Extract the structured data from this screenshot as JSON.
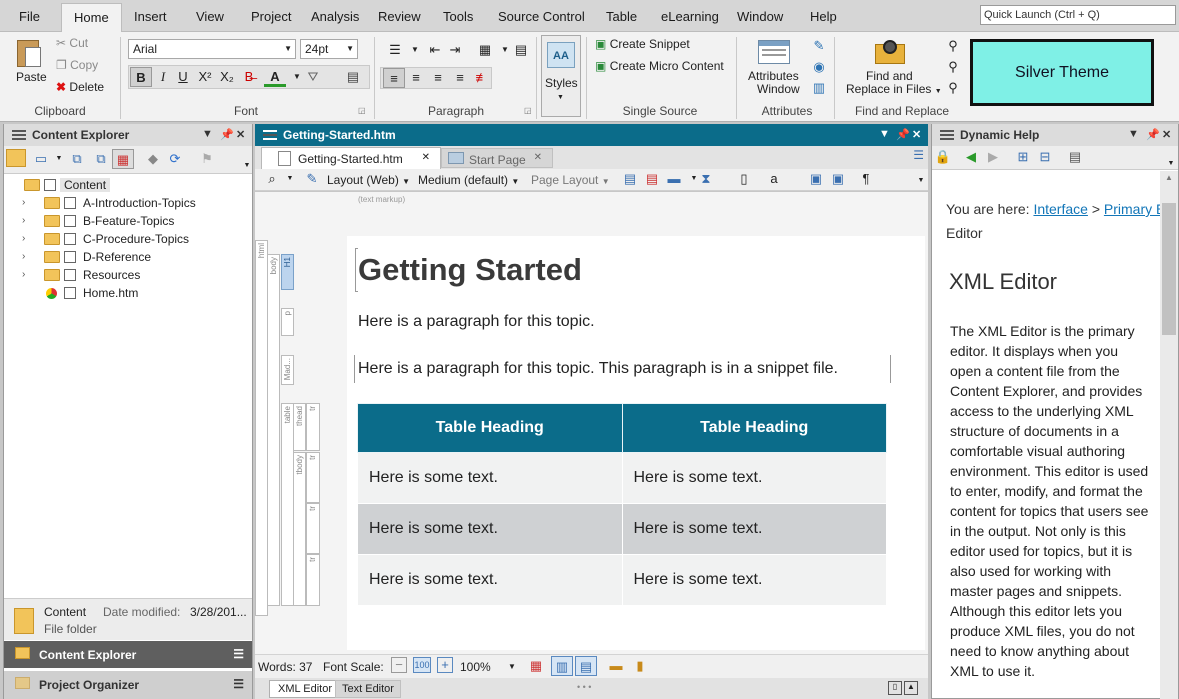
{
  "menu": {
    "items": [
      "File",
      "Home",
      "Insert",
      "View",
      "Project",
      "Analysis",
      "Review",
      "Tools",
      "Source Control",
      "Table",
      "eLearning",
      "Window",
      "Help"
    ],
    "active": "Home",
    "quick_launch": "Quick Launch (Ctrl + Q)"
  },
  "ribbon": {
    "clipboard": {
      "label": "Clipboard",
      "paste": "Paste",
      "cut": "Cut",
      "copy": "Copy",
      "delete": "Delete"
    },
    "font": {
      "label": "Font",
      "family": "Arial",
      "size": "24pt",
      "bold": "B",
      "italic": "I",
      "underline": "U",
      "superscript": "X²",
      "subscript": "X₂",
      "strike": "B̶",
      "font_color": "A"
    },
    "paragraph": {
      "label": "Paragraph"
    },
    "styles": {
      "label": "Styles"
    },
    "single_source": {
      "label": "Single Source",
      "create_snippet": "Create Snippet",
      "create_micro": "Create Micro Content"
    },
    "attributes": {
      "label": "Attributes",
      "window_line1": "Attributes",
      "window_line2": "Window"
    },
    "find": {
      "label": "Find and Replace",
      "btn_line1": "Find and",
      "btn_line2": "Replace in Files"
    },
    "theme": "Silver Theme"
  },
  "content_explorer": {
    "title": "Content Explorer",
    "root": "Content",
    "items": [
      "A-Introduction-Topics",
      "B-Feature-Topics",
      "C-Procedure-Topics",
      "D-Reference",
      "Resources",
      "Home.htm"
    ],
    "info": {
      "name": "Content",
      "modified_label": "Date modified:",
      "modified_value": "3/28/201...",
      "type": "File folder"
    },
    "bottom_tabs": [
      "Content Explorer",
      "Project Organizer"
    ]
  },
  "editor": {
    "window_title": "Getting-Started.htm",
    "tabs": [
      "Getting-Started.htm",
      "Start Page"
    ],
    "toolbar": {
      "layout": "Layout (Web)",
      "medium": "Medium (default)",
      "page_layout": "Page Layout"
    },
    "text_markup": "(text markup)",
    "structure_tags": [
      "html",
      "body",
      "H1",
      "p",
      "Mad...",
      "table",
      "thead",
      "tr",
      "tbody",
      "tr",
      "tr",
      "tr"
    ],
    "heading": "Getting Started",
    "para1": "Here is a paragraph for this topic.",
    "para2": "Here is a paragraph for this topic. This paragraph is in a snippet file.",
    "table": {
      "headers": [
        "Table Heading",
        "Table Heading"
      ],
      "rows": [
        [
          "Here is some text.",
          "Here is some text."
        ],
        [
          "Here is some text.",
          "Here is some text."
        ],
        [
          "Here is some text.",
          "Here is some text."
        ]
      ]
    },
    "status": {
      "words": "Words: 37",
      "font_scale": "Font Scale:",
      "zoom": "100%"
    },
    "bottom_tabs": [
      "XML Editor",
      "Text Editor"
    ]
  },
  "dynamic_help": {
    "title": "Dynamic Help",
    "you_are_here": "You are here:",
    "crumb1": "Interface",
    "crumb_sep": ">",
    "crumb2": "Primary E",
    "crumb3": "Editor",
    "heading": "XML Editor",
    "body": "The XML Editor is the primary editor. It displays when you open a content file from the Content Explorer, and provides access to the underlying XML structure of documents in a comfortable visual authoring environment. This editor is used to enter, modify, and format the content for topics that users see in the output. Not only is this editor used for topics, but it is also used for working with master pages and snippets. Although this editor lets you produce XML files, you do not need to know anything about XML to use it."
  },
  "colors": {
    "accent": "#0b6c8a",
    "theme_box": "#7ff0e6",
    "row_even": "#cfd1d3",
    "row_odd": "#f1f2f2"
  }
}
